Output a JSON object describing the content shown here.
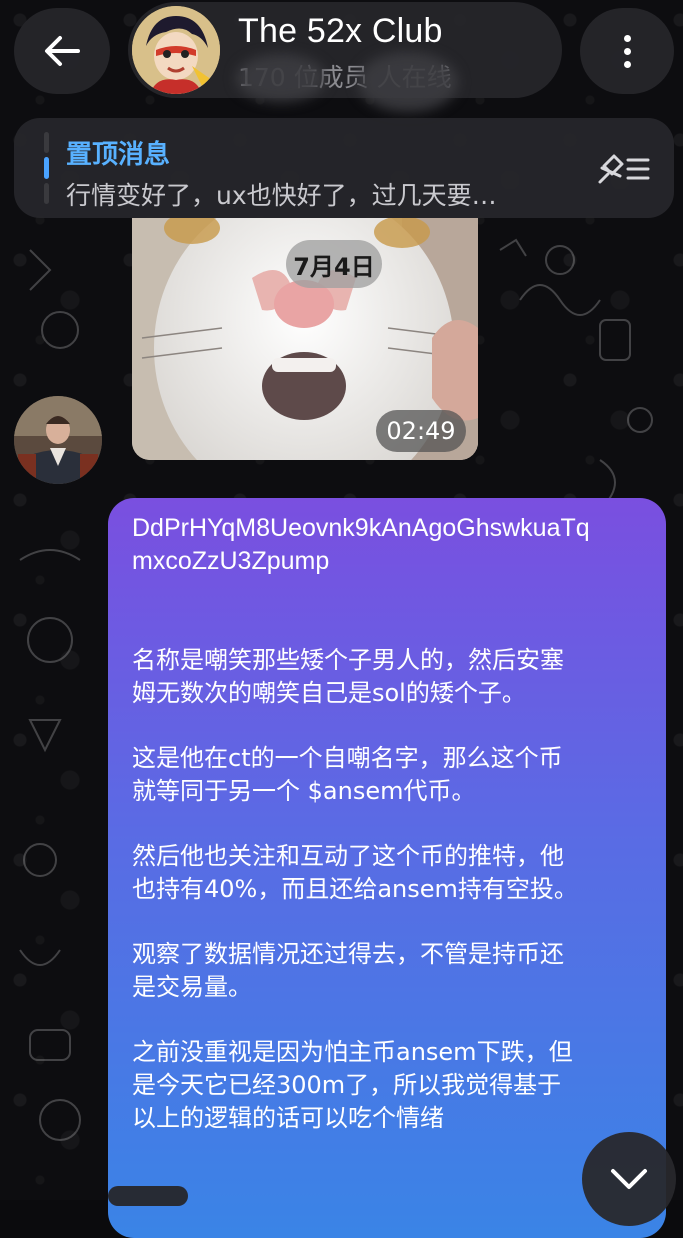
{
  "header": {
    "title": "The 52x Club",
    "subtitle": "170 位成员 人在线"
  },
  "pinned": {
    "title": "置顶消息",
    "text": "行情变好了，ux也快好了，过几天要…"
  },
  "video": {
    "date": "7月4日",
    "duration": "02:49"
  },
  "message": {
    "address": "DdPrHYqM8Ueovnk9kAnAgoGhswkuaTq\nmxcoZzU3Zpump",
    "p1": "名称是嘲笑那些矮个子男人的，然后安塞\n姆无数次的嘲笑自己是sol的矮个子。",
    "p2": "这是他在ct的一个自嘲名字，那么这个币\n就等同于另一个 $ansem代币。",
    "p3": "然后他也关注和互动了这个币的推特，他\n也持有40%，而且还给ansem持有空投。",
    "p4": "观察了数据情况还过得去，不管是持币还\n是交易量。",
    "p5": "之前没重视是因为怕主币ansem下跌，但\n是今天它已经300m了，所以我觉得基于\n以上的逻辑的话可以吃个情绪"
  },
  "colors": {
    "accent": "#58b1ff",
    "bubble_top": "#7a4fe0",
    "bubble_bottom": "#3a84e6",
    "background": "#0d0d10"
  },
  "icons": {
    "back": "arrow-left-icon",
    "menu": "more-vertical-icon",
    "pinned_list": "pin-list-icon",
    "scroll": "chevron-down-icon"
  }
}
